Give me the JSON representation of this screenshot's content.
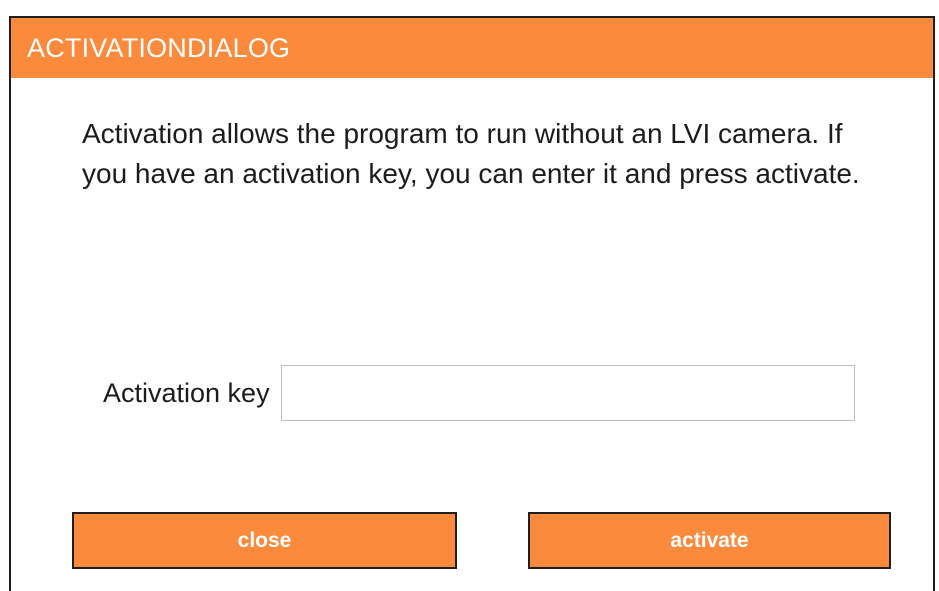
{
  "dialog": {
    "title": "ACTIVATIONDIALOG",
    "message": "Activation allows the program to run without an LVI camera. If you have an activation key, you can enter it and press activate.",
    "activation_key_label": "Activation key",
    "activation_key_value": "",
    "close_label": "close",
    "activate_label": "activate"
  },
  "colors": {
    "accent": "#fb8a3c",
    "text": "#1c1c1c",
    "button_text": "#ffffff"
  }
}
